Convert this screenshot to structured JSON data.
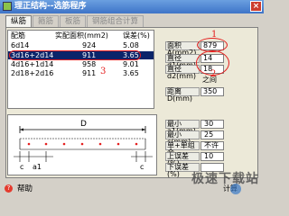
{
  "window": {
    "title": "理正结构--选筋程序",
    "close_label": "×"
  },
  "tabs": [
    {
      "label": "纵筋"
    },
    {
      "label": "箍筋"
    },
    {
      "label": "板筋"
    },
    {
      "label": "钢筋组合计算"
    }
  ],
  "list": {
    "headers": {
      "spec": "配筋",
      "area": "实配面积(mm2)",
      "error": "误差(%)"
    },
    "rows": [
      {
        "spec": "6d14",
        "area": "924",
        "error": "5.08"
      },
      {
        "spec": "3d16+2d14",
        "area": "911",
        "error": "3.65"
      },
      {
        "spec": "4d16+1d14",
        "area": "958",
        "error": "9.01"
      },
      {
        "spec": "2d18+2d16",
        "area": "911",
        "error": "3.65"
      }
    ],
    "selected_index": 1
  },
  "inputs": {
    "area_label": "面积A(mm2)",
    "area_value": "879",
    "d1_label": "直径d1(mm)",
    "d1_value": "14",
    "d2_label": "直径d2(mm)",
    "d2_value": "18",
    "between_text": "之间",
    "distance_label": "距离D(mm)",
    "distance_value": "350"
  },
  "annotations": {
    "one": "1",
    "two": "2",
    "three": "3"
  },
  "diagram": {
    "label_d": "D",
    "label_c_left": "c",
    "label_c_right": "c",
    "label_a1": "a1"
  },
  "params": [
    {
      "label": "最小a1(mm)",
      "value": "30"
    },
    {
      "label": "最小c(mm)",
      "value": "25"
    },
    {
      "label": "单+单组合",
      "value": "不许"
    },
    {
      "label": "上误差(%)",
      "value": "10"
    },
    {
      "label": "下误差(%)",
      "value": ""
    }
  ],
  "footer": {
    "help_label": "帮助",
    "calc_label": "计算",
    "watermark": "极速下载站"
  }
}
